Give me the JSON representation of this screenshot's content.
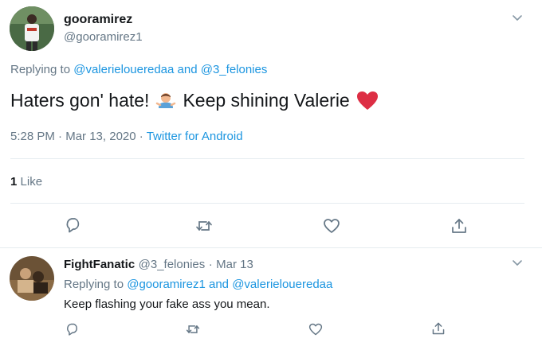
{
  "main_tweet": {
    "display_name": "gooramirez",
    "handle": "@gooramirez1",
    "replying_prefix": "Replying to",
    "reply_user_1": "@valerieloueredaa",
    "reply_and": "and",
    "reply_user_2": "@3_felonies",
    "text_part_1": "Haters gon' hate!",
    "text_part_2": "Keep shining Valerie",
    "time": "5:28 PM",
    "separator": "·",
    "date": "Mar 13, 2020",
    "source": "Twitter for Android",
    "likes_count": "1",
    "likes_label": "Like"
  },
  "reply_tweet": {
    "display_name": "FightFanatic",
    "handle": "@3_felonies",
    "separator": "·",
    "date": "Mar 13",
    "replying_prefix": "Replying to",
    "reply_user_1": "@gooramirez1",
    "reply_and": "and",
    "reply_user_2": "@valerieloueredaa",
    "text": "Keep flashing your fake ass you mean."
  },
  "icons": {
    "reply": "comment-icon",
    "retweet": "retweet-icon",
    "like": "heart-icon",
    "share": "share-icon",
    "menu": "chevron-down-icon",
    "emoji_1": "person-shrugging-emoji",
    "emoji_2": "red-heart-emoji"
  },
  "colors": {
    "link": "#1b95e0",
    "muted": "#657786",
    "text": "#14171a",
    "divider": "#e6ecf0",
    "heart": "#e0245e"
  }
}
